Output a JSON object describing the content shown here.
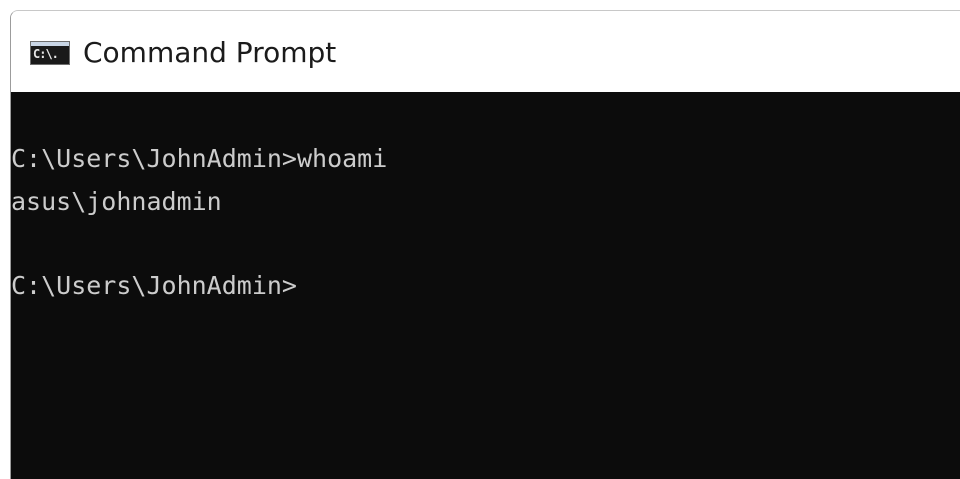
{
  "window": {
    "title": "Command Prompt",
    "icon": "console-icon",
    "icon_glyph": "C:\\."
  },
  "console": {
    "lines": [
      "C:\\Users\\JohnAdmin>whoami",
      "asus\\johnadmin",
      "",
      "C:\\Users\\JohnAdmin>"
    ]
  },
  "colors": {
    "console_background": "#0c0c0c",
    "console_text": "#cccccc",
    "titlebar_background": "#ffffff",
    "title_text": "#1b1b1b"
  }
}
